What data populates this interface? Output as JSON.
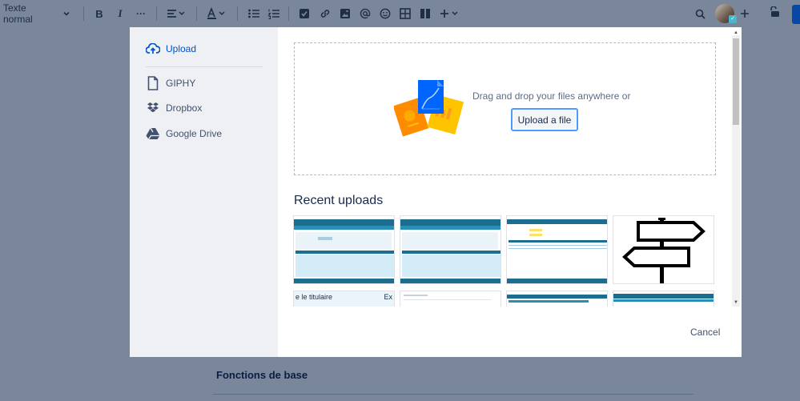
{
  "toolbar": {
    "text_style": "Texte normal",
    "bold": "B",
    "italic": "I",
    "more": "···"
  },
  "dialog": {
    "sidebar": [
      {
        "label": "Upload",
        "icon": "cloud-upload-icon",
        "active": true
      },
      {
        "label": "GIPHY",
        "icon": "file-icon",
        "active": false
      },
      {
        "label": "Dropbox",
        "icon": "dropbox-icon",
        "active": false
      },
      {
        "label": "Google Drive",
        "icon": "google-drive-icon",
        "active": false
      }
    ],
    "drop_text": "Drag and drop your files anywhere or",
    "upload_button": "Upload a file",
    "recent_title": "Recent uploads",
    "thumbs_row2": [
      {
        "left_text": "e le titulaire",
        "right_text": "Ex"
      }
    ],
    "cancel": "Cancel"
  },
  "document": {
    "heading": "Fonctions de base"
  },
  "colors": {
    "accent": "#0052cc",
    "overlay": "#7a869a",
    "focus": "#4c9aff"
  }
}
